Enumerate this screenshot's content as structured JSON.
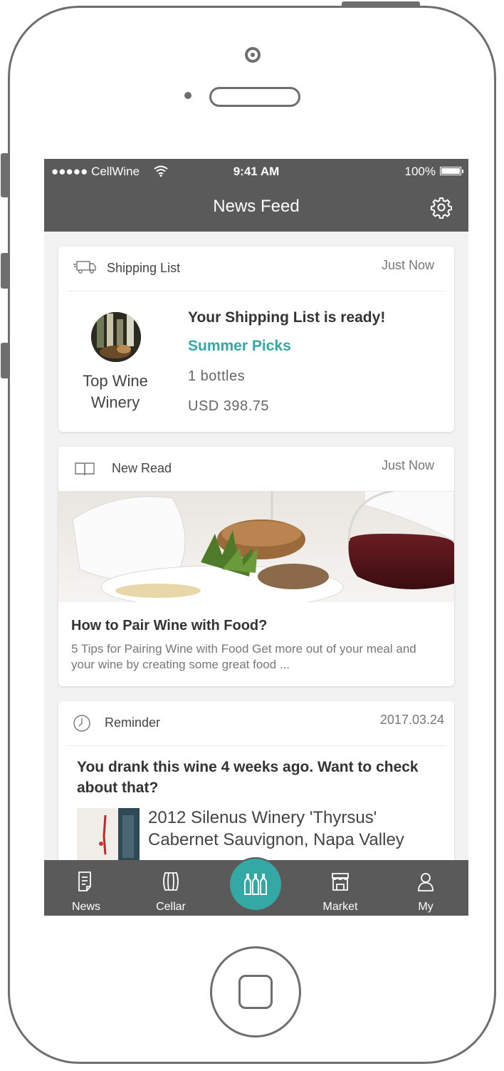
{
  "status_bar": {
    "carrier": "●●●●● CellWine",
    "time": "9:41 AM",
    "battery": "100%"
  },
  "header": {
    "title": "News Feed"
  },
  "feed": {
    "shipping": {
      "label": "Shipping List",
      "time": "Just Now",
      "winery": "Top Wine Winery",
      "title": "Your Shipping List is ready!",
      "list_name": "Summer Picks",
      "bottles": "1  bottles",
      "price": "USD 398.75"
    },
    "new_read": {
      "label": "New Read",
      "time": "Just Now",
      "title": "How to Pair Wine with Food?",
      "description": "5 Tips for Pairing Wine with Food Get more out of your meal and your wine by creating some great food ..."
    },
    "reminder": {
      "label": "Reminder",
      "date": "2017.03.24",
      "question": "You drank this wine 4 weeks ago. Want to check about that?",
      "wine_name": "2012 Silenus Winery 'Thyrsus' Cabernet Sauvignon, Napa Valley"
    }
  },
  "tabs": [
    {
      "label": "News",
      "icon": "news-icon"
    },
    {
      "label": "Cellar",
      "icon": "barrel-icon"
    },
    {
      "label": "",
      "icon": "bottles-icon"
    },
    {
      "label": "Market",
      "icon": "store-icon"
    },
    {
      "label": "My",
      "icon": "person-icon"
    }
  ],
  "colors": {
    "bar": "#5a5a5a",
    "accent": "#33a8a5",
    "background": "#f2f2f2"
  }
}
